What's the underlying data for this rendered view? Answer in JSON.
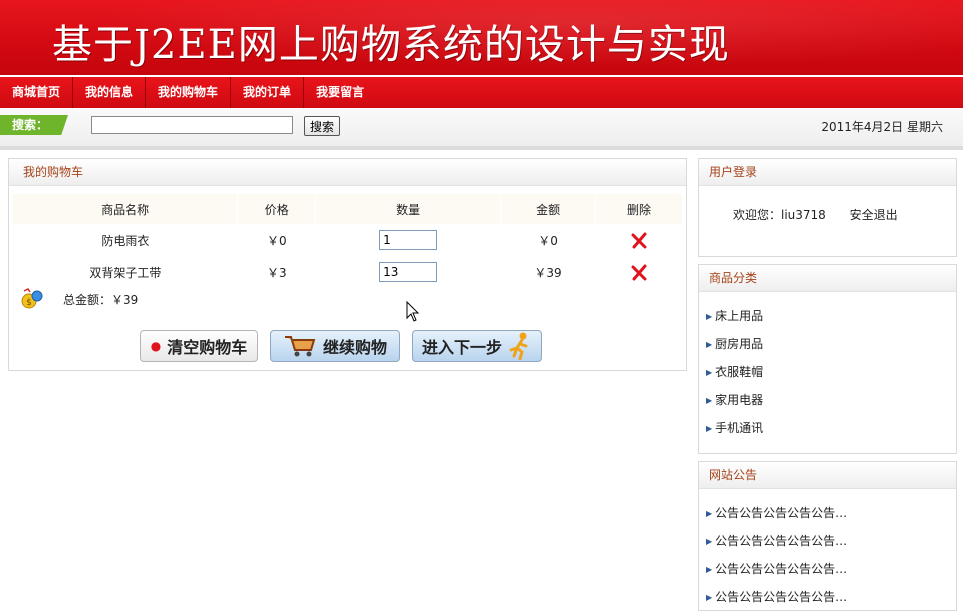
{
  "banner": {
    "title": "基于J2EE网上购物系统的设计与实现"
  },
  "nav": {
    "items": [
      {
        "label": "商城首页"
      },
      {
        "label": "我的信息"
      },
      {
        "label": "我的购物车"
      },
      {
        "label": "我的订单"
      },
      {
        "label": "我要留言"
      }
    ]
  },
  "search": {
    "label": "搜索：",
    "value": "",
    "button_label": "搜索",
    "date": "2011年4月2日 星期六"
  },
  "cart": {
    "title": "我的购物车",
    "headers": [
      "商品名称",
      "价格",
      "数量",
      "金额",
      "删除"
    ],
    "rows": [
      {
        "name": "防电雨衣",
        "price": "￥0",
        "qty": "1",
        "amount": "￥0"
      },
      {
        "name": "双背架子工带",
        "price": "￥3",
        "qty": "13",
        "amount": "￥39"
      }
    ],
    "total_label": "总金额：￥39",
    "buttons": {
      "clear": "清空购物车",
      "continue": "继续购物",
      "next": "进入下一步"
    }
  },
  "login": {
    "title": "用户登录",
    "welcome": "欢迎您：liu3718",
    "logout": "安全退出"
  },
  "categories": {
    "title": "商品分类",
    "items": [
      "床上用品",
      "厨房用品",
      "衣服鞋帽",
      "家用电器",
      "手机通讯"
    ]
  },
  "notices": {
    "title": "网站公告",
    "items": [
      "公告公告公告公告公告…",
      "公告公告公告公告公告…",
      "公告公告公告公告公告…",
      "公告公告公告公告公告…"
    ]
  },
  "colors": {
    "brand_red": "#d40a12",
    "search_label_green": "#6fb52c",
    "panel_title": "#a5431a",
    "delete_red": "#e0141c"
  }
}
